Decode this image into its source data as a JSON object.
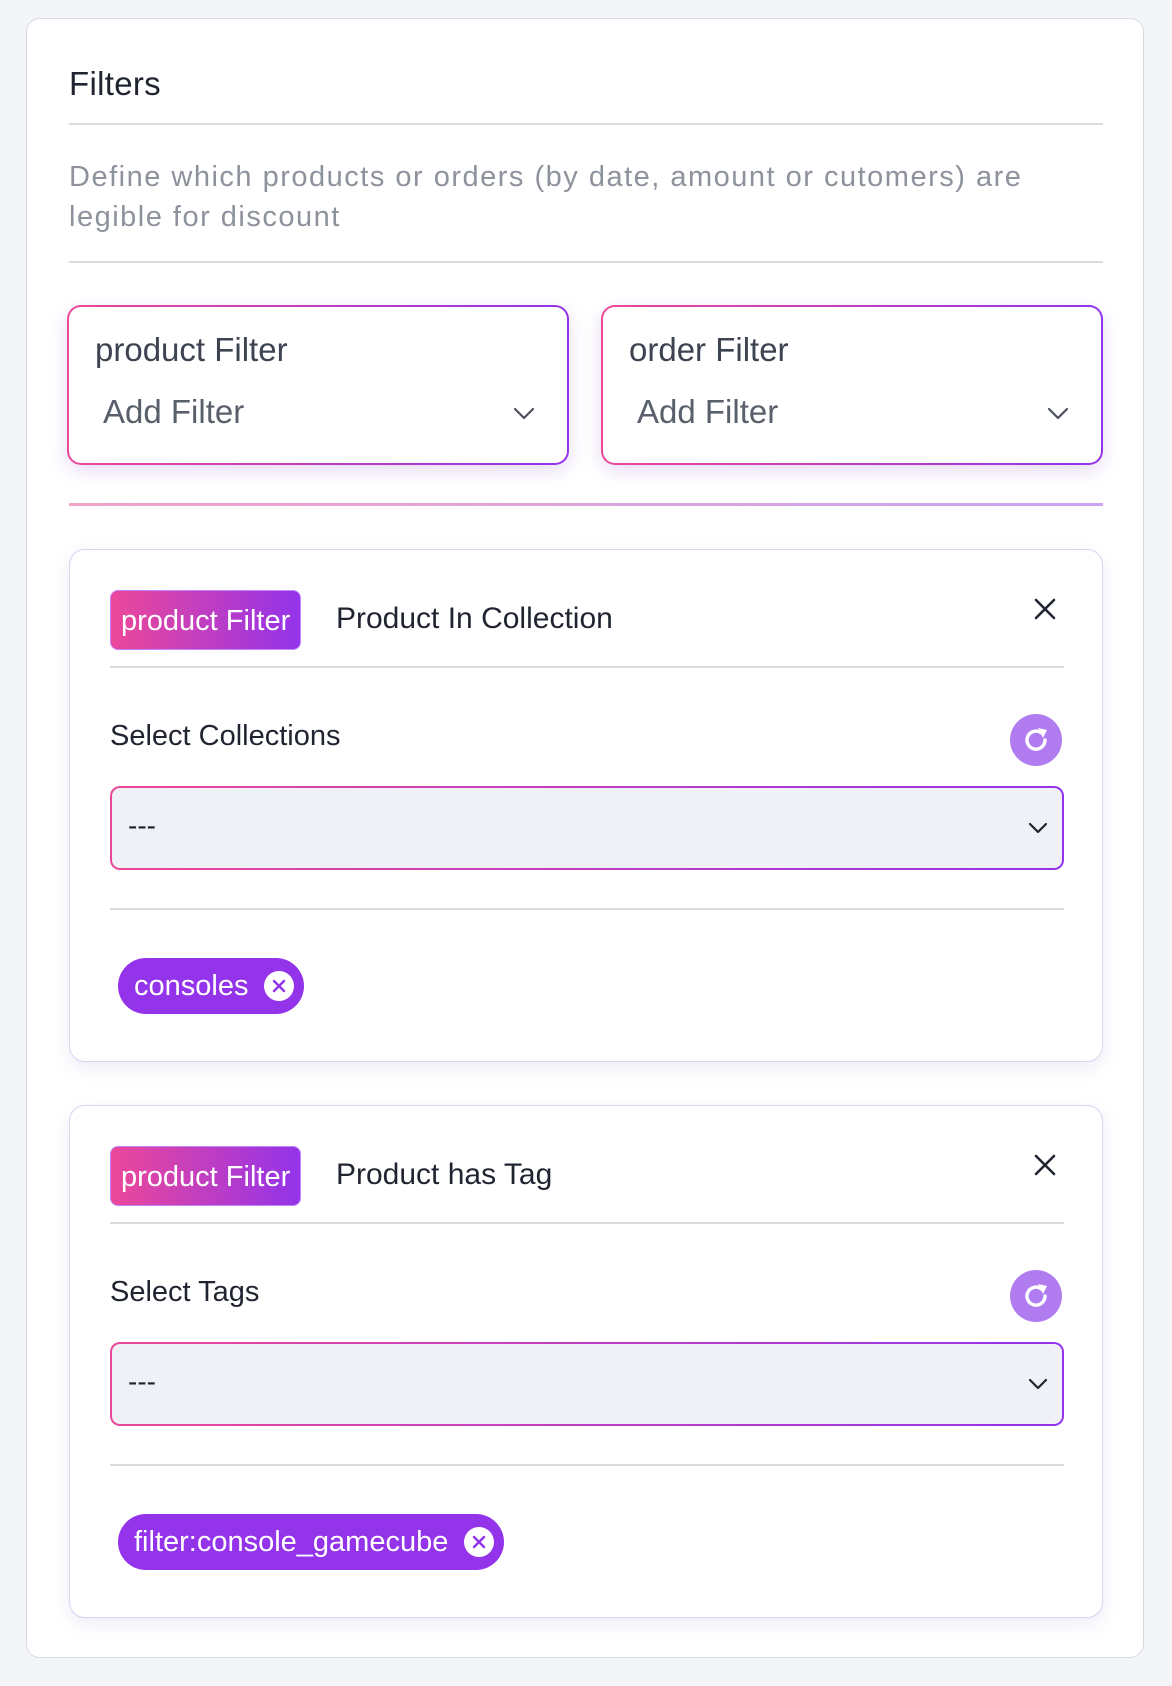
{
  "filters_card": {
    "title": "Filters",
    "description": "Define which products or orders (by date, amount or cutomers) are legible for discount"
  },
  "pickers": [
    {
      "label": "product Filter",
      "value": "Add Filter",
      "icon": "chevron-down-icon"
    },
    {
      "label": "order Filter",
      "value": "Add Filter",
      "icon": "chevron-down-icon"
    }
  ],
  "filter_blocks": [
    {
      "badge": "product Filter",
      "title": "Product In Collection",
      "field_label": "Select Collections",
      "select_value": "---",
      "chips": [
        "consoles"
      ]
    },
    {
      "badge": "product Filter",
      "title": "Product has Tag",
      "field_label": "Select Tags",
      "select_value": "---",
      "chips": [
        "filter:console_gamecube"
      ]
    }
  ],
  "colors": {
    "accent_pink": "#ec4899",
    "accent_purple": "#9333ea",
    "refresh_button": "#b07cf0",
    "muted_text": "#8d929c"
  },
  "icons": {
    "close": "close-icon",
    "refresh": "refresh-icon",
    "chip_remove": "x-circle-icon",
    "select_chevron": "chevron-down-icon"
  }
}
